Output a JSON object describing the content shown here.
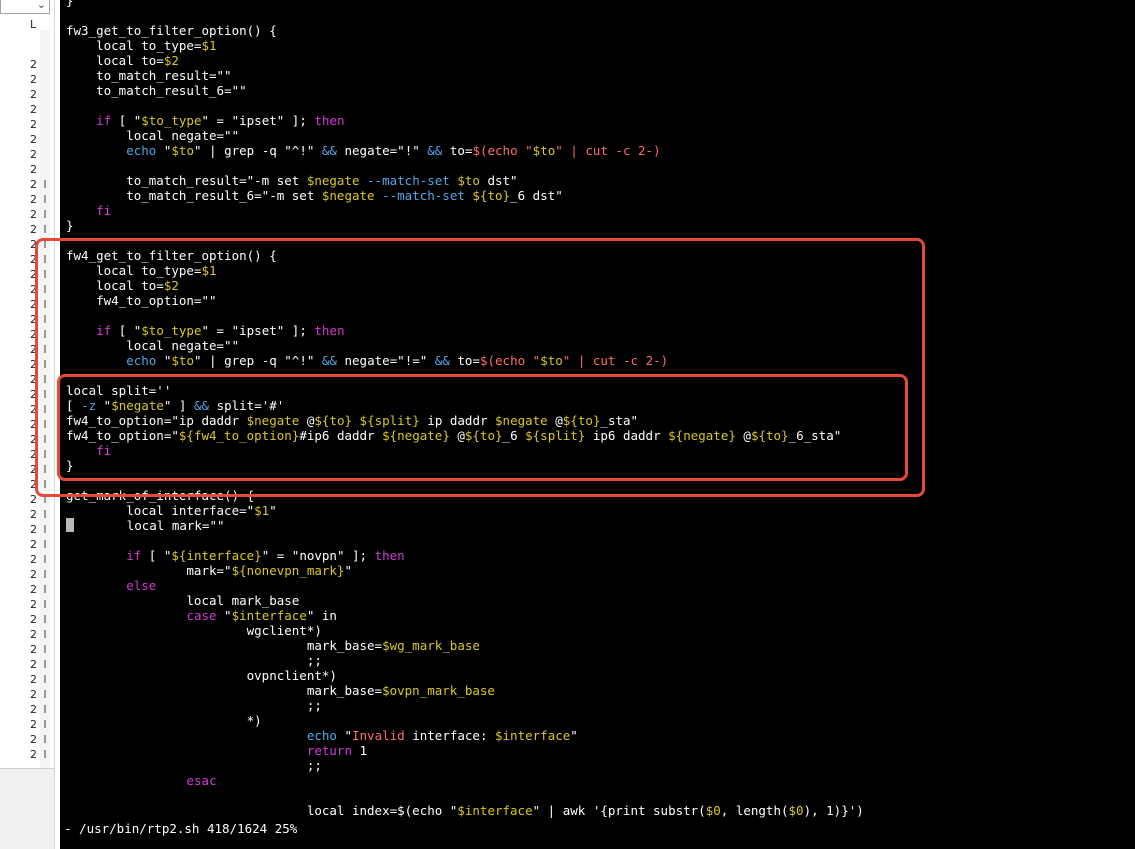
{
  "left_panel": {
    "column_header": "L",
    "dropdown_icon": "chevron-down-icon",
    "line_markers": [
      "2",
      "2",
      "2",
      "2",
      "2",
      "2",
      "2",
      "2",
      "2",
      "2",
      "2",
      "2",
      "2",
      "2",
      "2",
      "2",
      "2",
      "2",
      "2",
      "2",
      "2",
      "2",
      "2",
      "2",
      "2",
      "2",
      "2",
      "2",
      "2",
      "2",
      "2",
      "2",
      "2",
      "2",
      "2",
      "2",
      "2",
      "2",
      "2",
      "2",
      "2",
      "2",
      "2",
      "2",
      "2",
      "2",
      "2"
    ]
  },
  "editor": {
    "status_line": "- /usr/bin/rtp2.sh 418/1624 25%",
    "lines": [
      [
        [
          "}",
          ""
        ]
      ],
      [
        [
          "",
          ""
        ]
      ],
      [
        [
          "fw3_get_to_filter_option() {",
          ""
        ]
      ],
      [
        [
          "    local to_type=",
          ""
        ],
        [
          "$1",
          "vr"
        ]
      ],
      [
        [
          "    local to=",
          ""
        ],
        [
          "$2",
          "vr"
        ]
      ],
      [
        [
          "    to_match_result=\"\"",
          ""
        ]
      ],
      [
        [
          "    to_match_result_6=\"\"",
          ""
        ]
      ],
      [
        [
          "",
          ""
        ]
      ],
      [
        [
          "    ",
          ""
        ],
        [
          "if",
          "kw"
        ],
        [
          " [ \"",
          ""
        ],
        [
          "$to_type",
          "vr"
        ],
        [
          "\" = \"ipset\" ]; ",
          ""
        ],
        [
          "then",
          "kw"
        ]
      ],
      [
        [
          "        local negate=\"\"",
          ""
        ]
      ],
      [
        [
          "        ",
          ""
        ],
        [
          "echo",
          "cm"
        ],
        [
          " \"",
          ""
        ],
        [
          "$to",
          "vr"
        ],
        [
          "\" | grep -q \"^!\" ",
          ""
        ],
        [
          "&&",
          "cm"
        ],
        [
          " negate=\"!\" ",
          ""
        ],
        [
          "&&",
          "cm"
        ],
        [
          " to=",
          ""
        ],
        [
          "$(echo \"",
          "st"
        ],
        [
          "$to",
          "vr"
        ],
        [
          "\" | cut -c 2-)",
          "st"
        ]
      ],
      [
        [
          "",
          ""
        ]
      ],
      [
        [
          "        to_match_result=\"-m set ",
          ""
        ],
        [
          "$negate",
          "vr"
        ],
        [
          " --match-set ",
          "cm"
        ],
        [
          "$to",
          "vr"
        ],
        [
          " dst\"",
          ""
        ]
      ],
      [
        [
          "        to_match_result_6=\"-m set ",
          ""
        ],
        [
          "$negate",
          "vr"
        ],
        [
          " --match-set ",
          "cm"
        ],
        [
          "${to}",
          "vr"
        ],
        [
          "_6 dst\"",
          ""
        ]
      ],
      [
        [
          "    ",
          ""
        ],
        [
          "fi",
          "kw"
        ]
      ],
      [
        [
          "}",
          ""
        ]
      ],
      [
        [
          "",
          ""
        ]
      ],
      [
        [
          "fw4_get_to_filter_option() {",
          ""
        ]
      ],
      [
        [
          "    local to_type=",
          ""
        ],
        [
          "$1",
          "vr"
        ]
      ],
      [
        [
          "    local to=",
          ""
        ],
        [
          "$2",
          "vr"
        ]
      ],
      [
        [
          "    fw4_to_option=\"\"",
          ""
        ]
      ],
      [
        [
          "",
          ""
        ]
      ],
      [
        [
          "    ",
          ""
        ],
        [
          "if",
          "kw"
        ],
        [
          " [ \"",
          ""
        ],
        [
          "$to_type",
          "vr"
        ],
        [
          "\" = \"ipset\" ]; ",
          ""
        ],
        [
          "then",
          "kw"
        ]
      ],
      [
        [
          "        local negate=\"\"",
          ""
        ]
      ],
      [
        [
          "        ",
          ""
        ],
        [
          "echo",
          "cm"
        ],
        [
          " \"",
          ""
        ],
        [
          "$to",
          "vr"
        ],
        [
          "\" | grep -q \"^!\" ",
          ""
        ],
        [
          "&&",
          "cm"
        ],
        [
          " negate=\"!=\" ",
          ""
        ],
        [
          "&&",
          "cm"
        ],
        [
          " to=",
          ""
        ],
        [
          "$(echo \"",
          "st"
        ],
        [
          "$to",
          "vr"
        ],
        [
          "\" | cut -c 2-)",
          "st"
        ]
      ],
      [
        [
          "",
          ""
        ]
      ],
      [
        [
          "local split=''",
          ""
        ]
      ],
      [
        [
          "[ ",
          ""
        ],
        [
          "-z",
          "cm"
        ],
        [
          " \"",
          ""
        ],
        [
          "$negate",
          "vr"
        ],
        [
          "\" ] ",
          ""
        ],
        [
          "&&",
          "cm"
        ],
        [
          " split='#'",
          ""
        ]
      ],
      [
        [
          "fw4_to_option=\"ip daddr ",
          ""
        ],
        [
          "$negate",
          "vr"
        ],
        [
          " @",
          ""
        ],
        [
          "${to}",
          "vr"
        ],
        [
          " ",
          ""
        ],
        [
          "${split}",
          "vr"
        ],
        [
          " ip daddr ",
          ""
        ],
        [
          "$negate",
          "vr"
        ],
        [
          " @",
          ""
        ],
        [
          "${to}",
          "vr"
        ],
        [
          "_sta\"",
          ""
        ]
      ],
      [
        [
          "fw4_to_option=\"",
          ""
        ],
        [
          "${fw4_to_option}",
          "vr"
        ],
        [
          "#ip6 daddr ",
          ""
        ],
        [
          "${negate}",
          "vr"
        ],
        [
          " @",
          ""
        ],
        [
          "${to}",
          "vr"
        ],
        [
          "_6 ",
          ""
        ],
        [
          "${split}",
          "vr"
        ],
        [
          " ip6 daddr ",
          ""
        ],
        [
          "${negate}",
          "vr"
        ],
        [
          " @",
          ""
        ],
        [
          "${to}",
          "vr"
        ],
        [
          "_6_sta\"",
          ""
        ]
      ],
      [
        [
          "    ",
          ""
        ],
        [
          "fi",
          "kw"
        ]
      ],
      [
        [
          "}",
          ""
        ]
      ],
      [
        [
          "",
          ""
        ]
      ],
      [
        [
          "get_mark_of_interface() {",
          ""
        ]
      ],
      [
        [
          "        local interface=\"",
          ""
        ],
        [
          "$1",
          "vr"
        ],
        [
          "\"",
          ""
        ]
      ],
      [
        [
          "",
          "cursor"
        ],
        [
          "       local mark=\"\"",
          ""
        ]
      ],
      [
        [
          "",
          ""
        ]
      ],
      [
        [
          "        ",
          ""
        ],
        [
          "if",
          "kw"
        ],
        [
          " [ \"",
          ""
        ],
        [
          "${interface}",
          "vr"
        ],
        [
          "\" = \"novpn\" ]; ",
          ""
        ],
        [
          "then",
          "kw"
        ]
      ],
      [
        [
          "                mark=\"",
          ""
        ],
        [
          "${nonevpn_mark}",
          "vr"
        ],
        [
          "\"",
          ""
        ]
      ],
      [
        [
          "        ",
          ""
        ],
        [
          "else",
          "kw"
        ]
      ],
      [
        [
          "                local mark_base",
          ""
        ]
      ],
      [
        [
          "                ",
          ""
        ],
        [
          "case",
          "kw"
        ],
        [
          " \"",
          ""
        ],
        [
          "$interface",
          "vr"
        ],
        [
          "\" in",
          ""
        ]
      ],
      [
        [
          "                        wgclient*)",
          ""
        ]
      ],
      [
        [
          "                                mark_base=",
          ""
        ],
        [
          "$wg_mark_base",
          "vr"
        ]
      ],
      [
        [
          "                                ;;",
          ""
        ]
      ],
      [
        [
          "                        ovpnclient*)",
          ""
        ]
      ],
      [
        [
          "                                mark_base=",
          ""
        ],
        [
          "$ovpn_mark_base",
          "vr"
        ]
      ],
      [
        [
          "                                ;;",
          ""
        ]
      ],
      [
        [
          "                        *)",
          ""
        ]
      ],
      [
        [
          "                                ",
          ""
        ],
        [
          "echo",
          "cm"
        ],
        [
          " \"",
          ""
        ],
        [
          "Invalid",
          "st"
        ],
        [
          " interface: ",
          ""
        ],
        [
          "$interface",
          "vr"
        ],
        [
          "\"",
          ""
        ]
      ],
      [
        [
          "                                ",
          ""
        ],
        [
          "return",
          "kw"
        ],
        [
          " 1",
          ""
        ]
      ],
      [
        [
          "                                ;;",
          ""
        ]
      ],
      [
        [
          "                ",
          ""
        ],
        [
          "esac",
          "kw"
        ]
      ],
      [
        [
          "",
          ""
        ]
      ],
      [
        [
          "                                local index=$(echo \"",
          ""
        ],
        [
          "$interface",
          "vr"
        ],
        [
          "\" | awk '{print substr(",
          ""
        ],
        [
          "$0",
          "vr"
        ],
        [
          ", length(",
          ""
        ],
        [
          "$0",
          "vr"
        ],
        [
          "), 1)}')",
          ""
        ]
      ]
    ]
  },
  "annotations": {
    "color": "#e34a3a"
  }
}
